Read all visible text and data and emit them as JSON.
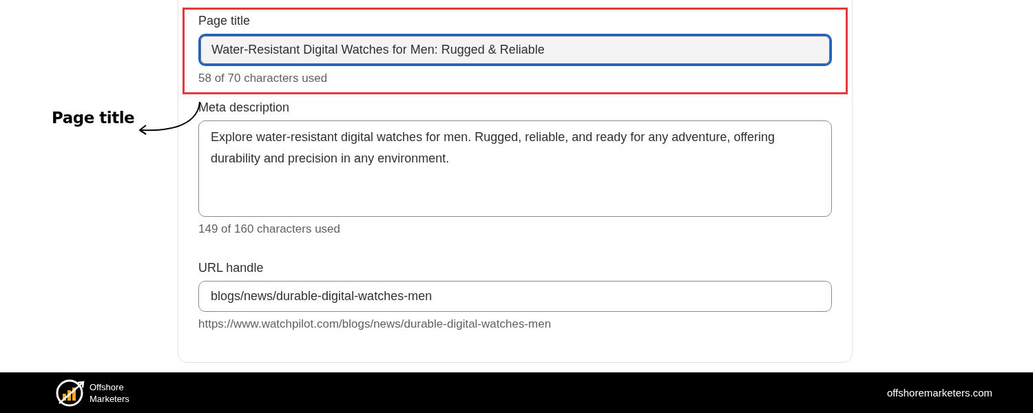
{
  "annotation": {
    "label": "Page title"
  },
  "fields": [
    {
      "kind": "input",
      "label": "Page title",
      "value": "Water-Resistant Digital Watches for Men: Rugged & Reliable",
      "help": "58 of 70 characters used",
      "focused": true,
      "highlighted": true
    },
    {
      "kind": "textarea",
      "label": "Meta description",
      "value": "Explore water-resistant digital watches for men. Rugged, reliable, and ready for any adventure, offering durability and precision in any environment.",
      "help": "149 of 160 characters used",
      "focused": false,
      "highlighted": false
    },
    {
      "kind": "input",
      "label": "URL handle",
      "value": "blogs/news/durable-digital-watches-men",
      "help": "https://www.watchpilot.com/blogs/news/durable-digital-watches-men",
      "focused": false,
      "highlighted": false
    }
  ],
  "footer": {
    "brand_line_1": "Offshore",
    "brand_line_2": "Marketers",
    "site": "offshoremarketers.com"
  }
}
